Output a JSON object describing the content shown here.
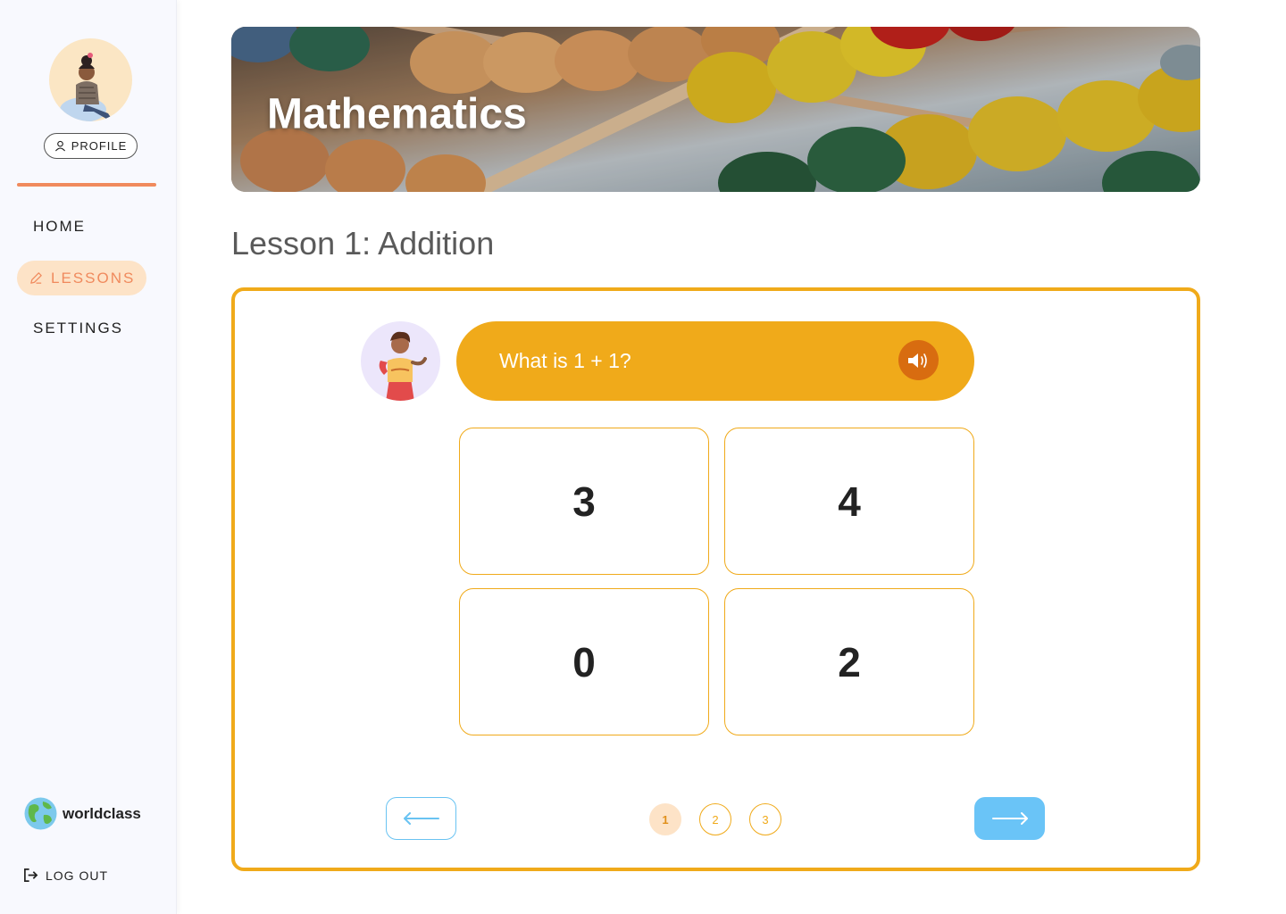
{
  "sidebar": {
    "profile_label": "PROFILE",
    "nav": [
      {
        "label": "HOME",
        "active": false
      },
      {
        "label": "LESSONS",
        "active": true
      },
      {
        "label": "SETTINGS",
        "active": false
      }
    ],
    "brand": "worldclass",
    "logout_label": "LOG OUT"
  },
  "banner": {
    "title": "Mathematics"
  },
  "lesson": {
    "title": "Lesson 1: Addition"
  },
  "quiz": {
    "question": "What is 1 + 1?",
    "answers": [
      "3",
      "4",
      "0",
      "2"
    ],
    "pages": [
      "1",
      "2",
      "3"
    ],
    "current_page": "1"
  },
  "colors": {
    "accent_orange": "#f08a5d",
    "quiz_yellow": "#f0aa1a",
    "speaker_orange": "#d86c10",
    "nav_blue": "#6ac4f7",
    "active_nav_bg": "#fde3c7"
  },
  "icons": [
    "user-icon",
    "pencil-icon",
    "globe-icon",
    "logout-icon",
    "speaker-icon",
    "arrow-left-icon",
    "arrow-right-icon"
  ]
}
